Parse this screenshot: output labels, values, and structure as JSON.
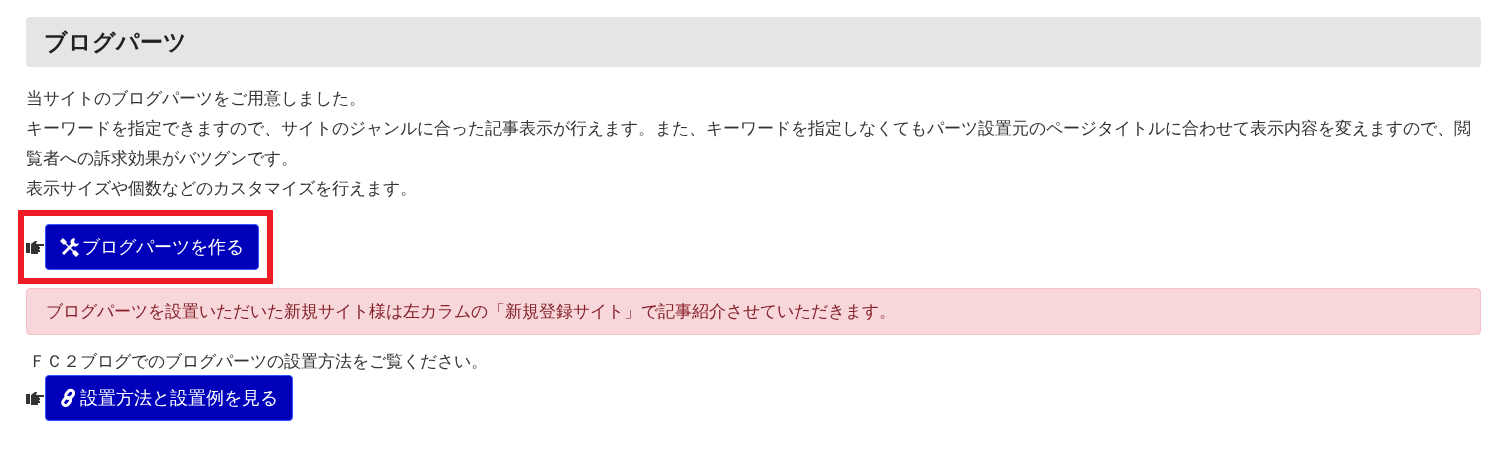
{
  "heading": "ブログパーツ",
  "intro": [
    "当サイトのブログパーツをご用意しました。",
    "キーワードを指定できますので、サイトのジャンルに合った記事表示が行えます。また、キーワードを指定しなくてもパーツ設置元のページタイトルに合わせて表示内容を変えますので、閲覧者への訴求効果がバツグンです。",
    "表示サイズや個数などのカスタマイズを行えます。"
  ],
  "create_button": {
    "label": "ブログパーツを作る",
    "highlighted": true
  },
  "alert": "ブログパーツを設置いただいた新規サイト様は左カラムの「新規登録サイト」で記事紹介させていただきます。",
  "howto_text": "ＦＣ２ブログでのブログパーツの設置方法をご覧ください。",
  "howto_button": {
    "label": "設置方法と設置例を見る"
  }
}
